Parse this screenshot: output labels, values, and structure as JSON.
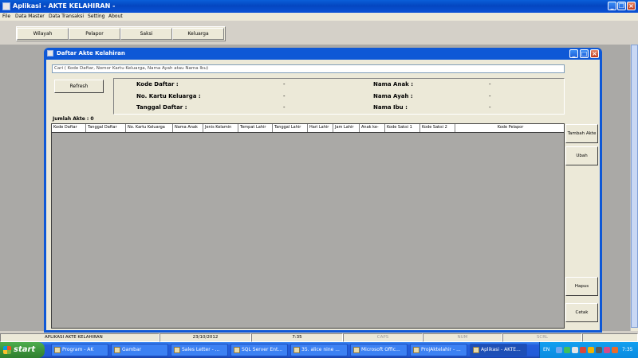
{
  "window": {
    "title": "Aplikasi - AKTE KELAHIRAN -"
  },
  "menu": [
    "File",
    "Data Master",
    "Data Transaksi",
    "Setting",
    "About"
  ],
  "toolbar": [
    "Wilayah",
    "Pelapor",
    "Saksi",
    "Keluarga"
  ],
  "child": {
    "title": "Daftar Akte Kelahiran",
    "search_text": "Cari ( Kode Daftar, Nomor Kartu Keluarga, Nama Ayah atau Nama Ibu)",
    "refresh_label": "Refresh",
    "labels": {
      "kode_daftar": "Kode Daftar :",
      "no_kk": "No. Kartu Keluarga :",
      "tanggal_daftar": "Tanggal Daftar :",
      "nama_anak": "Nama Anak :",
      "nama_ayah": "Nama Ayah :",
      "nama_ibu": "Nama Ibu :"
    },
    "values": {
      "kode_daftar": "-",
      "no_kk": "-",
      "tanggal_daftar": "-",
      "nama_anak": "-",
      "nama_ayah": "-",
      "nama_ibu": "-"
    },
    "jumlah_label": "Jumlah Akte : 0",
    "columns": [
      "Kode Daftar",
      "Tanggal Daftar",
      "No. Kartu Keluarga",
      "Nama Anak",
      "Jenis Kelamin",
      "Tempat Lahir",
      "Tanggal Lahir",
      "Hari Lahir",
      "Jam Lahir",
      "Anak ke-",
      "Kode Saksi 1",
      "Kode Saksi 2",
      "Kode Pelapor"
    ],
    "buttons": {
      "tambah": "Tambah Akte",
      "ubah": "Ubah",
      "hapus": "Hapus",
      "cetak": "Cetak"
    }
  },
  "status": {
    "app": "APLIKASI AKTE KELAHIRAN",
    "date": "23/10/2012",
    "time": "7:35",
    "caps": "CAPS",
    "num": "NUM",
    "scrl": "SCRL"
  },
  "taskbar": {
    "start": "start",
    "tasks": [
      "Program - AK",
      "Gambar",
      "Sales Letter - ...",
      "SQL Server Ent...",
      "35. alice nine ...",
      "Microsoft Offic...",
      "ProjAktelahir - ...",
      "Aplikasi - AKTE..."
    ],
    "lang": "EN",
    "clock": "7:35"
  }
}
